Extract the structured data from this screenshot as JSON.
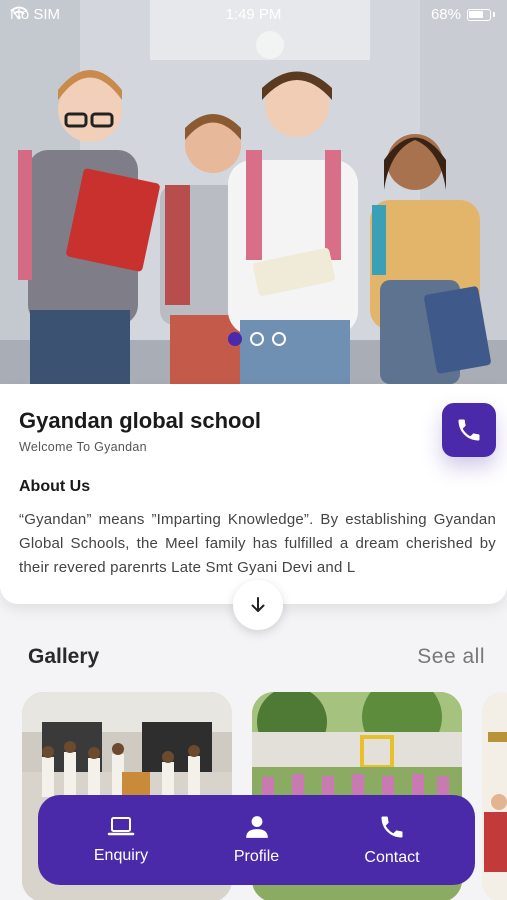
{
  "status_bar": {
    "carrier": "No SIM",
    "time": "1:49 PM",
    "battery": "68%"
  },
  "hero": {
    "slide_count": 3,
    "active_slide": 1
  },
  "school": {
    "title": "Gyandan global school",
    "subtitle": "Welcome To Gyandan",
    "about_title": "About Us",
    "about_text": "“Gyandan” means ”Imparting Knowledge”. By establishing Gyandan Global Schools, the Meel family has fulfilled a dream cherished by their revered parenrts Late Smt Gyani Devi and L"
  },
  "gallery": {
    "title": "Gallery",
    "see_all": "See all"
  },
  "bottom_nav": {
    "items": [
      {
        "label": "Enquiry",
        "icon": "laptop-icon"
      },
      {
        "label": "Profile",
        "icon": "person-icon"
      },
      {
        "label": "Contact",
        "icon": "phone-icon"
      }
    ]
  },
  "colors": {
    "accent": "#4a2aa8",
    "background": "#f4f4f6",
    "card": "#ffffff"
  }
}
